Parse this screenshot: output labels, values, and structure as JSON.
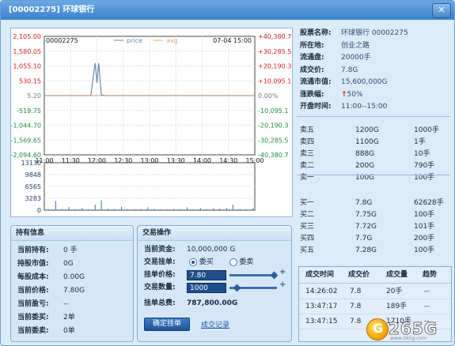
{
  "window": {
    "title": "[00002275] 环球银行",
    "close_glyph": "✕"
  },
  "chart": {
    "code": "00002275",
    "legend": [
      "price",
      "avg"
    ],
    "timestamp": "07-04 15:00",
    "left_ticks": [
      "2,105.00",
      "1,580.05",
      "1,055.10",
      "530.15",
      "5.20",
      "-519.75",
      "-1,044.70",
      "-1,569.65",
      "-2,094.60"
    ],
    "right_ticks": [
      "+40,380.7",
      "+30,285.5",
      "+20,190.3",
      "+10,095.1",
      "0.00%",
      "-10,095.1",
      "-20,190.3",
      "-30,285.5",
      "-40,380.7"
    ],
    "x_ticks": [
      "11:00",
      "11:30",
      "12:00",
      "12:30",
      "13:00",
      "13:30",
      "14:00",
      "14:30",
      "15:00"
    ],
    "volume_ticks": [
      "13130",
      "9848",
      "6565",
      "3283",
      "0"
    ],
    "colors": {
      "price": "#6a8ab0",
      "avg": "#f0a060",
      "up": "#d02020",
      "down": "#1f8a3a"
    }
  },
  "chart_data": {
    "type": "line",
    "x_range": [
      "11:00",
      "15:00"
    ],
    "ylim": [
      -2094.6,
      2105.0
    ],
    "base": 5.2,
    "price": {
      "x": [
        "11:00",
        "11:45",
        "11:53",
        "11:56",
        "11:58",
        "12:00",
        "12:02",
        "12:05",
        "12:10",
        "12:20",
        "13:00",
        "15:00"
      ],
      "values": [
        5.2,
        5.2,
        5.2,
        700,
        1160,
        450,
        1160,
        30,
        5.2,
        5.2,
        5.2,
        5.2
      ]
    },
    "volume": {
      "ylim": [
        0,
        13130
      ],
      "x": [
        "11:05",
        "11:13",
        "11:20",
        "11:28",
        "11:35",
        "11:43",
        "11:50",
        "11:58",
        "12:05",
        "12:13",
        "12:20",
        "12:28",
        "12:35",
        "12:43",
        "12:50",
        "12:58",
        "13:05",
        "13:13",
        "13:20",
        "13:28",
        "13:35",
        "13:43",
        "13:50",
        "13:58",
        "14:05",
        "14:13",
        "14:20",
        "14:28",
        "14:35",
        "14:43",
        "14:50",
        "14:58"
      ],
      "values": [
        200,
        2500,
        300,
        900,
        250,
        600,
        200,
        1500,
        2700,
        400,
        300,
        900,
        200,
        250,
        300,
        800,
        300,
        250,
        200,
        350,
        250,
        800,
        200,
        600,
        300,
        500,
        400,
        600,
        1500,
        300,
        250,
        600
      ]
    }
  },
  "info": [
    {
      "k": "股票名称:",
      "v": "环球银行 00002275"
    },
    {
      "k": "所在地:",
      "v": "创业之路"
    },
    {
      "k": "流通盘:",
      "v": "20000手"
    },
    {
      "k": "成交价:",
      "v": "7.8G"
    },
    {
      "k": "流通市值:",
      "v": "15,600,000G"
    },
    {
      "k": "涨跌幅:",
      "arrow": "↑",
      "v": "50%"
    },
    {
      "k": "开盘时间:",
      "v": "11:00--15:00"
    }
  ],
  "asks": [
    {
      "label": "卖五",
      "price": "1200G",
      "qty": "1000手"
    },
    {
      "label": "卖四",
      "price": "1100G",
      "qty": "1手"
    },
    {
      "label": "卖三",
      "price": "888G",
      "qty": "10手"
    },
    {
      "label": "卖二",
      "price": "200G",
      "qty": "790手"
    },
    {
      "label": "卖一",
      "price": "100G",
      "qty": "100手"
    }
  ],
  "bids": [
    {
      "label": "买一",
      "price": "7.8G",
      "qty": "62628手"
    },
    {
      "label": "买二",
      "price": "7.75G",
      "qty": "100手"
    },
    {
      "label": "买三",
      "price": "7.72G",
      "qty": "101手"
    },
    {
      "label": "买四",
      "price": "7.7G",
      "qty": "200手"
    },
    {
      "label": "买五",
      "price": "7.28G",
      "qty": "100手"
    }
  ],
  "trades": {
    "headers": [
      "成交时间",
      "成交价",
      "成交量",
      "趋势"
    ],
    "rows": [
      {
        "time": "14:26:02",
        "price": "7.8",
        "qty": "20手",
        "trend": "--"
      },
      {
        "time": "13:47:17",
        "price": "7.8",
        "qty": "189手",
        "trend": "--"
      },
      {
        "time": "13:47:15",
        "price": "7.8",
        "qty": "1710手",
        "trend": "--"
      }
    ]
  },
  "holdings": {
    "title": "持有信息",
    "rows": [
      {
        "k": "当前持有:",
        "v": "0 手"
      },
      {
        "k": "持股市值:",
        "v": "0G"
      },
      {
        "k": "每股成本:",
        "v": "0.00G"
      },
      {
        "k": "当前价格:",
        "v": "7.80G"
      },
      {
        "k": "当前盈亏:",
        "v": "--"
      },
      {
        "k": "当前委买:",
        "v": "2单"
      },
      {
        "k": "当前委卖:",
        "v": "0单"
      }
    ]
  },
  "trade_panel": {
    "title": "交易操作",
    "funds_k": "当前资金:",
    "funds_v": "10,000,000 G",
    "order_k": "交易挂单:",
    "buy": "委买",
    "sell": "委卖",
    "price_k": "挂单价格:",
    "price_v": "7.80",
    "qty_k": "交易数量:",
    "qty_v": "1000",
    "total_k": "挂单总费:",
    "total_v": "787,800.00G",
    "confirm": "确定挂单",
    "records": "成交记录",
    "plus": "+"
  },
  "watermark": {
    "logo": "G",
    "text": "265G",
    "url": "www.265g.com"
  }
}
